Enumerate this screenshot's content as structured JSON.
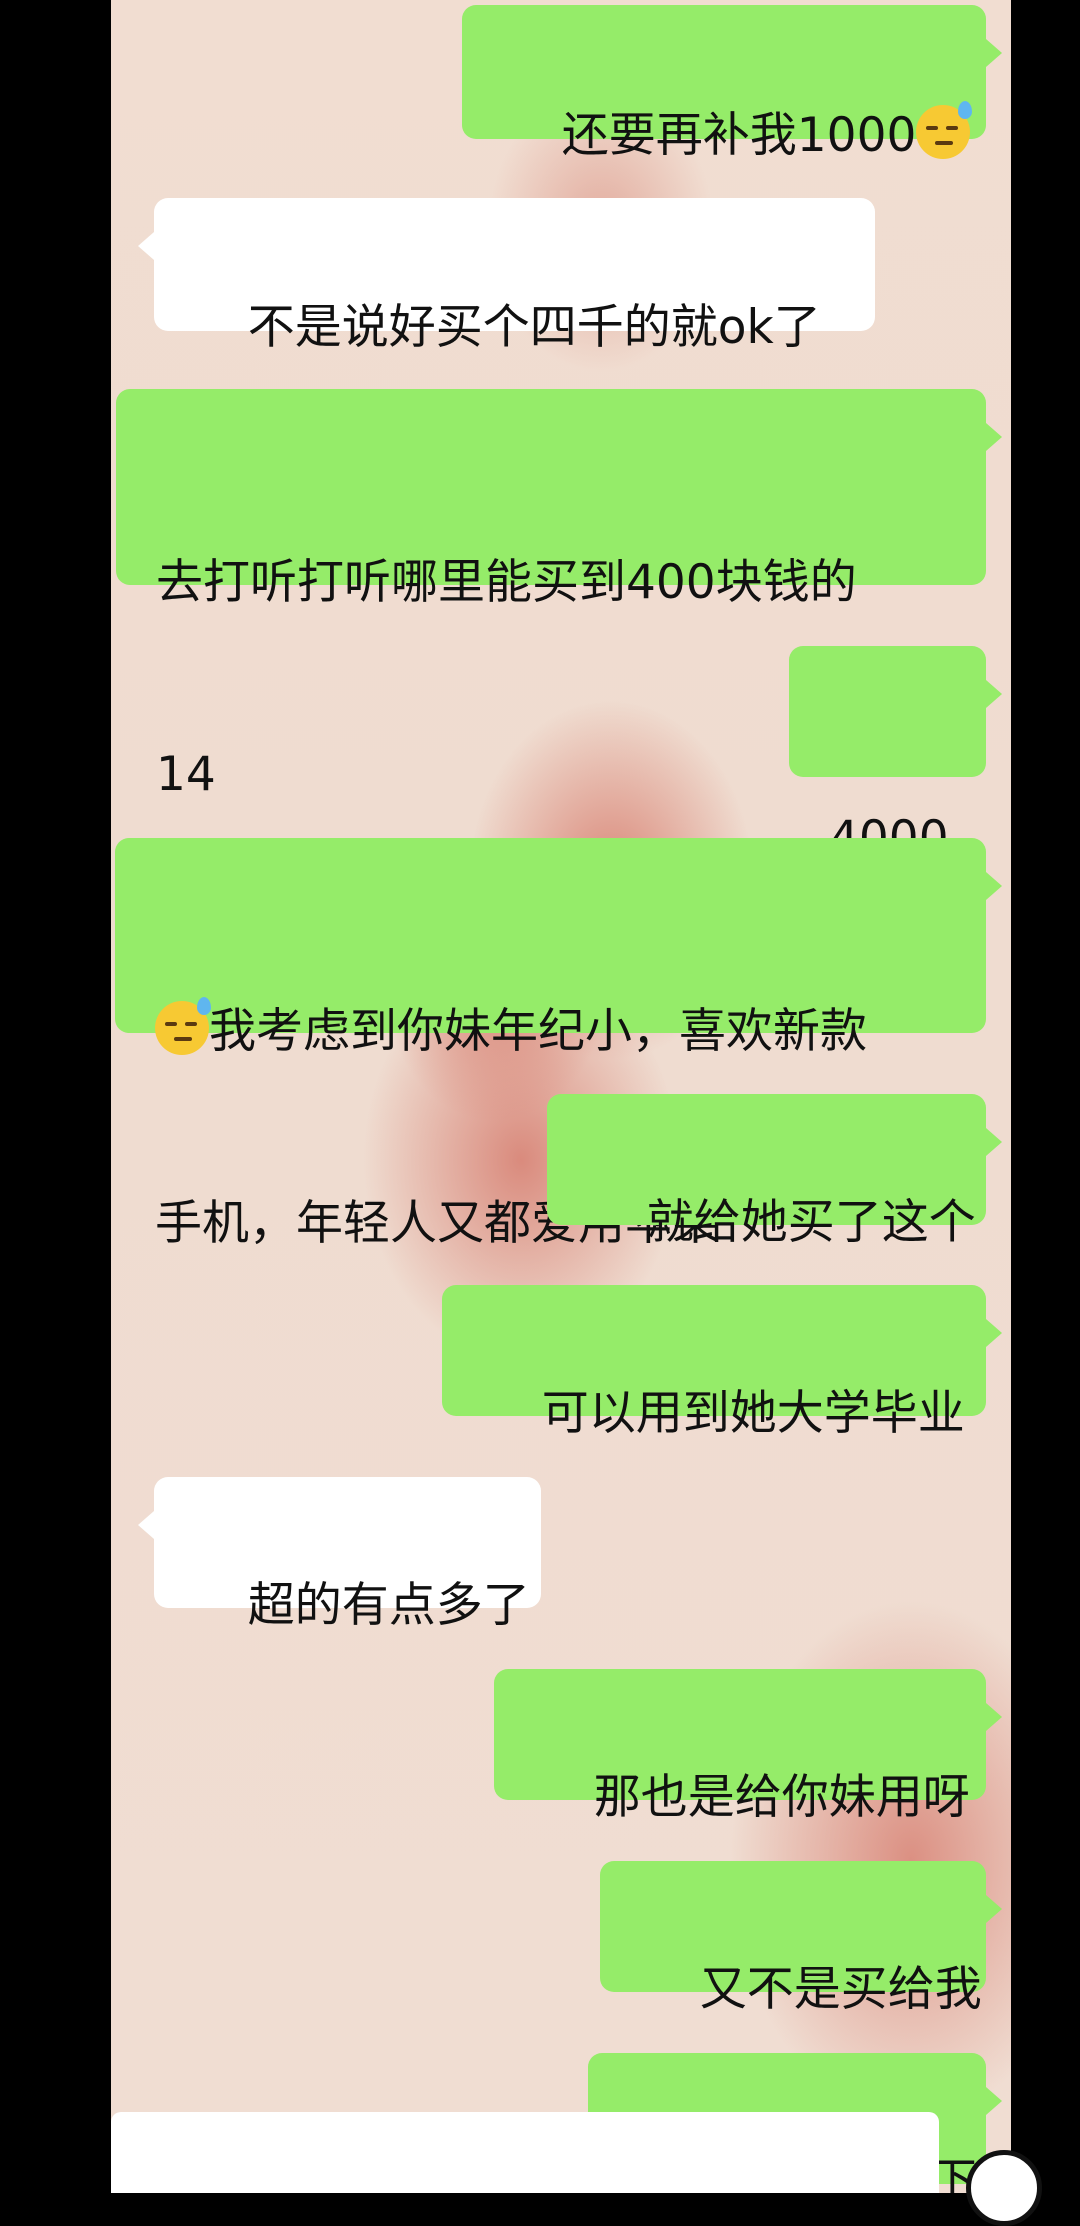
{
  "messages": [
    {
      "side": "me",
      "text": "还要再补我1000",
      "emoji_after": true
    },
    {
      "side": "them",
      "text": "不是说好买个四千的就ok了"
    },
    {
      "side": "me",
      "line1": "去打听打听哪里能买到400块钱的",
      "line2": "14"
    },
    {
      "side": "me",
      "text": "4000"
    },
    {
      "side": "me",
      "line1": "我考虑到你妹年纪小，喜欢新款",
      "line2": "手机，年轻人又都爱用苹果",
      "emoji_before": true
    },
    {
      "side": "me",
      "text": "就给她买了这个"
    },
    {
      "side": "me",
      "text": "可以用到她大学毕业"
    },
    {
      "side": "them",
      "text": "超的有点多了"
    },
    {
      "side": "me",
      "text": "那也是给你妹用呀"
    },
    {
      "side": "me",
      "text": "又不是买给我"
    },
    {
      "side": "me",
      "text": "你给我一下",
      "emoji_before": true,
      "partially_cut": true
    }
  ],
  "icons": {
    "emoji": "sweat-smile-emoji-icon",
    "voice": "voice-circle-icon"
  },
  "colors": {
    "my_bubble": "#95ec69",
    "their_bubble": "#ffffff",
    "background": "#f0ddd2",
    "heart": "#d67869"
  }
}
